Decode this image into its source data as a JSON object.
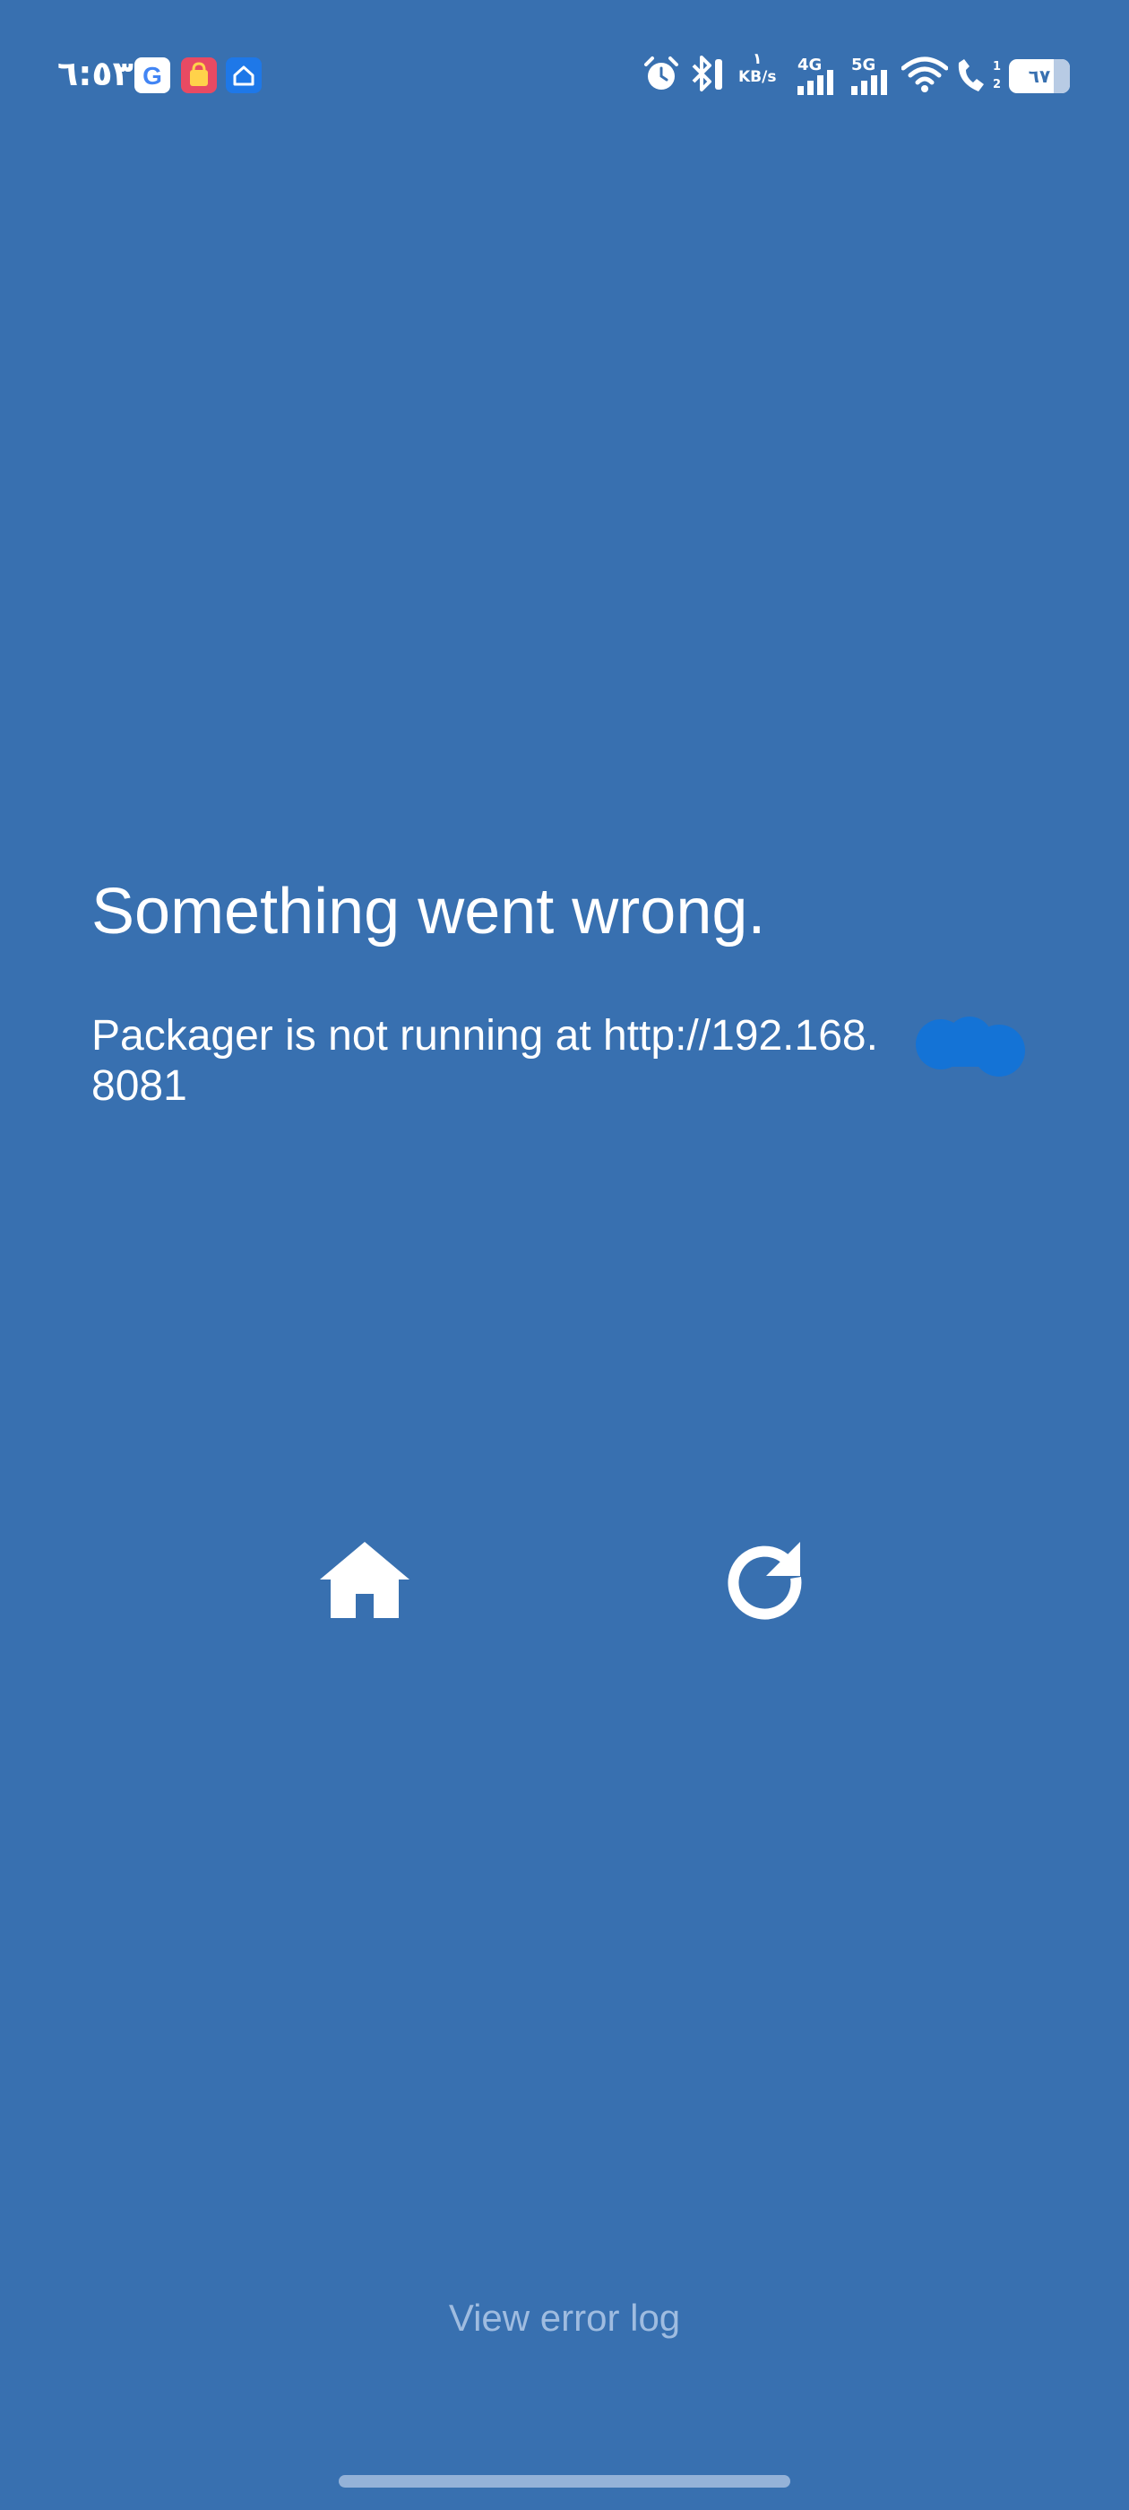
{
  "status_bar": {
    "time": "٦:٥٣",
    "net_speed_value": "١",
    "net_speed_unit": "KB/s",
    "network_4g": "4G",
    "network_5g": "5G",
    "battery": "٦٧",
    "icons": [
      "google-icon",
      "shopping-bag-icon",
      "smart-home-icon",
      "alarm-icon",
      "bluetooth-icon",
      "signal-icon",
      "wifi-icon",
      "wifi-calling-icon",
      "battery-icon"
    ]
  },
  "error": {
    "title": "Something went wrong.",
    "message": "Packager is not running at http://192.168.\n8081"
  },
  "actions": {
    "home_icon": "home-icon",
    "reload_icon": "reload-icon",
    "view_error_log": "View error log"
  },
  "colors": {
    "background": "#3870B0",
    "text": "#FFFFFF",
    "link_text": "#9FBCE0",
    "redaction": "#1473D6"
  }
}
